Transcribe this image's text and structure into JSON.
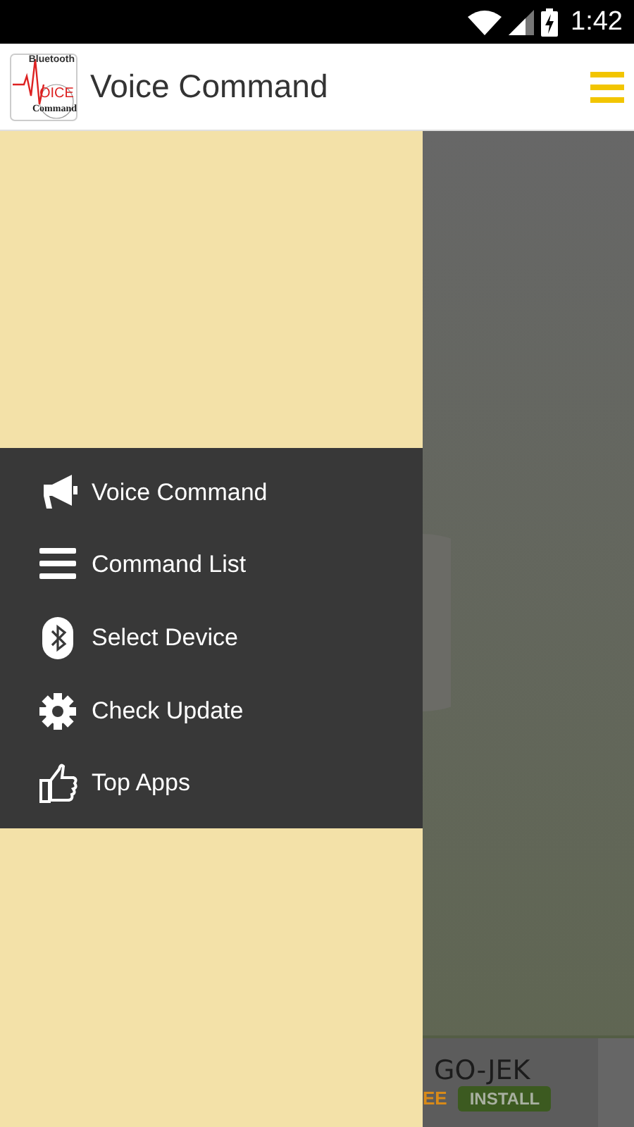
{
  "status_bar": {
    "time": "1:42"
  },
  "app_bar": {
    "logo": {
      "top": "Bluetooth",
      "word": "OICE",
      "bottom": "Command"
    },
    "title": "Voice Command"
  },
  "drawer": {
    "items": [
      {
        "label": "Voice Command",
        "kind": "megaphone"
      },
      {
        "label": "Command List",
        "kind": "list"
      },
      {
        "label": "Select Device",
        "kind": "bluetooth"
      },
      {
        "label": "Check Update",
        "kind": "gear"
      },
      {
        "label": "Top Apps",
        "kind": "thumbs-up"
      }
    ]
  },
  "ad": {
    "name": "GO-JEK",
    "price": "EE",
    "button": "INSTALL"
  }
}
